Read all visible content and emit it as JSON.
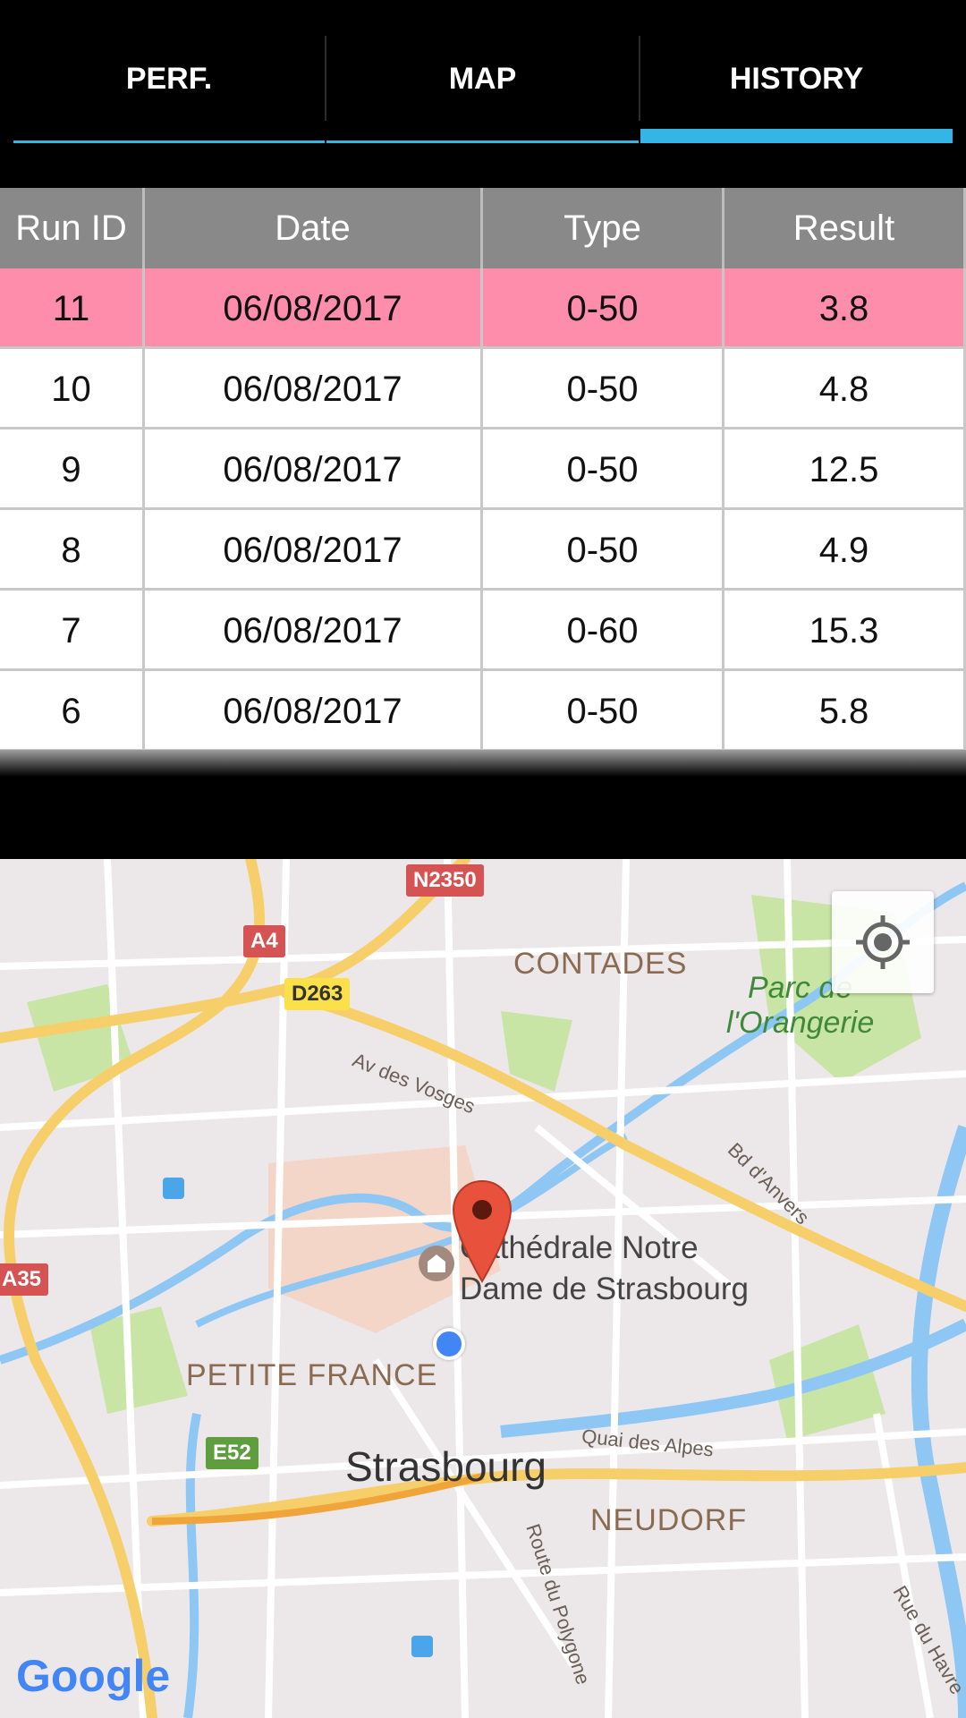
{
  "tabs": [
    {
      "label": "PERF.",
      "active": false
    },
    {
      "label": "MAP",
      "active": false
    },
    {
      "label": "HISTORY",
      "active": true
    }
  ],
  "table": {
    "headers": [
      "Run ID",
      "Date",
      "Type",
      "Result"
    ],
    "rows": [
      {
        "run_id": "11",
        "date": "06/08/2017",
        "type": "0-50",
        "result": "3.8",
        "highlighted": true
      },
      {
        "run_id": "10",
        "date": "06/08/2017",
        "type": "0-50",
        "result": "4.8"
      },
      {
        "run_id": "9",
        "date": "06/08/2017",
        "type": "0-50",
        "result": "12.5"
      },
      {
        "run_id": "8",
        "date": "06/08/2017",
        "type": "0-50",
        "result": "4.9"
      },
      {
        "run_id": "7",
        "date": "06/08/2017",
        "type": "0-60",
        "result": "15.3"
      },
      {
        "run_id": "6",
        "date": "06/08/2017",
        "type": "0-50",
        "result": "5.8"
      }
    ]
  },
  "map": {
    "city": "Strasbourg",
    "districts": [
      "CONTADES",
      "PETITE FRANCE",
      "NEUDORF"
    ],
    "park": {
      "line1": "Parc de",
      "line2": "l'Orangerie"
    },
    "poi": {
      "line1": "Cathédrale Notre",
      "line2": "Dame de Strasbourg"
    },
    "roads": [
      "Av des Vosges",
      "Bd d'Anvers",
      "Quai des Alpes",
      "Route du Polygone",
      "Rue du Havre"
    ],
    "shields": [
      "N2350",
      "A4",
      "D263",
      "A35",
      "E52"
    ],
    "logo": "Google",
    "icons": [
      "my-location-icon",
      "map-pin-icon",
      "current-location-dot-icon",
      "museum-icon",
      "transit-icon"
    ]
  },
  "colors": {
    "tab_indicator": "#33b5e5",
    "header_bg": "#898989",
    "highlight_row": "#fd8dab",
    "map_bg": "#ece8ea",
    "water": "#8ec6f4",
    "highway": "#f6cf6b",
    "park": "#c9e5a5"
  }
}
